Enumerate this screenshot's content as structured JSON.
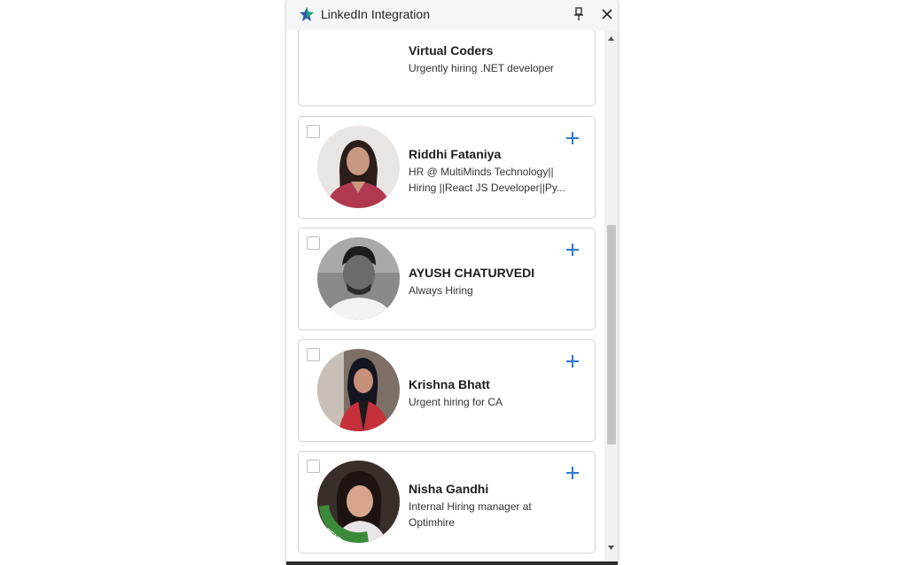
{
  "window": {
    "title": "LinkedIn Integration"
  },
  "icons": {
    "app": "linkedin-integration-star-icon",
    "pin": "pin-icon",
    "close": "close-icon",
    "add": "plus-icon"
  },
  "colors": {
    "accent": "#2a78d4",
    "star_green": "#1f9e7a",
    "star_blue": "#2b5aa8"
  },
  "contacts": [
    {
      "name": "Virtual Coders",
      "headline": "Urgently hiring .NET developer",
      "has_avatar": false
    },
    {
      "name": "Riddhi Fataniya",
      "headline_lines": [
        "HR @ MultiMinds Technology||",
        "Hiring ||React JS Developer||Py..."
      ],
      "has_avatar": true
    },
    {
      "name": "AYUSH CHATURVEDI",
      "headline": "Always Hiring",
      "has_avatar": true
    },
    {
      "name": "Krishna Bhatt",
      "headline": "Urgent hiring for CA",
      "has_avatar": true
    },
    {
      "name": "Nisha Gandhi",
      "headline_lines": [
        "Internal Hiring manager at",
        "Optimhire"
      ],
      "has_avatar": true,
      "avatar_badge": "#OPENTOWORK"
    }
  ]
}
